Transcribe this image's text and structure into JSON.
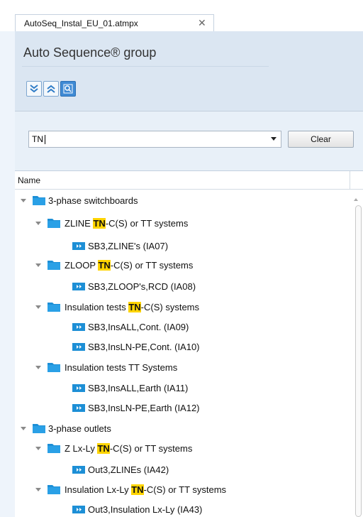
{
  "tab": {
    "title": "AutoSeq_Instal_EU_01.atmpx",
    "close": "✕"
  },
  "group": {
    "title": "Auto Sequence® group"
  },
  "toolbar": {
    "buttons": [
      {
        "icon": "expand-all-icon"
      },
      {
        "icon": "collapse-all-icon"
      },
      {
        "icon": "search-icon",
        "active": true
      }
    ]
  },
  "search": {
    "value": "TN",
    "clear_label": "Clear"
  },
  "header": {
    "name": "Name"
  },
  "tree": {
    "r0": {
      "label": "3-phase switchboards"
    },
    "r1": {
      "pre": "ZLINE ",
      "hl": "TN",
      "post": "-C(S) or TT systems"
    },
    "r2": {
      "label": "SB3,ZLINE's (IA07)"
    },
    "r3": {
      "pre": "ZLOOP ",
      "hl": "TN",
      "post": "-C(S) or TT systems"
    },
    "r4": {
      "label": "SB3,ZLOOP's,RCD (IA08)"
    },
    "r5": {
      "pre": "Insulation tests ",
      "hl": "TN",
      "post": "-C(S) systems"
    },
    "r6": {
      "label": "SB3,InsALL,Cont. (IA09)"
    },
    "r7": {
      "label": "SB3,InsLN-PE,Cont. (IA10)"
    },
    "r8": {
      "label": "Insulation tests TT Systems"
    },
    "r9": {
      "label": "SB3,InsALL,Earth (IA11)"
    },
    "r10": {
      "label": "SB3,InsLN-PE,Earth (IA12)"
    },
    "r11": {
      "label": "3-phase outlets"
    },
    "r12": {
      "pre": "Z Lx-Ly ",
      "hl": "TN",
      "post": "-C(S) or TT systems"
    },
    "r13": {
      "label": "Out3,ZLINEs (IA42)"
    },
    "r14": {
      "pre": "Insulation Lx-Ly ",
      "hl": "TN",
      "post": "-C(S) or TT systems"
    },
    "r15": {
      "label": "Out3,Insulation Lx-Ly (IA43)"
    }
  },
  "colors": {
    "folder": "#1d8fd6",
    "highlight": "#ffd400",
    "accent": "#3f8ad4"
  }
}
